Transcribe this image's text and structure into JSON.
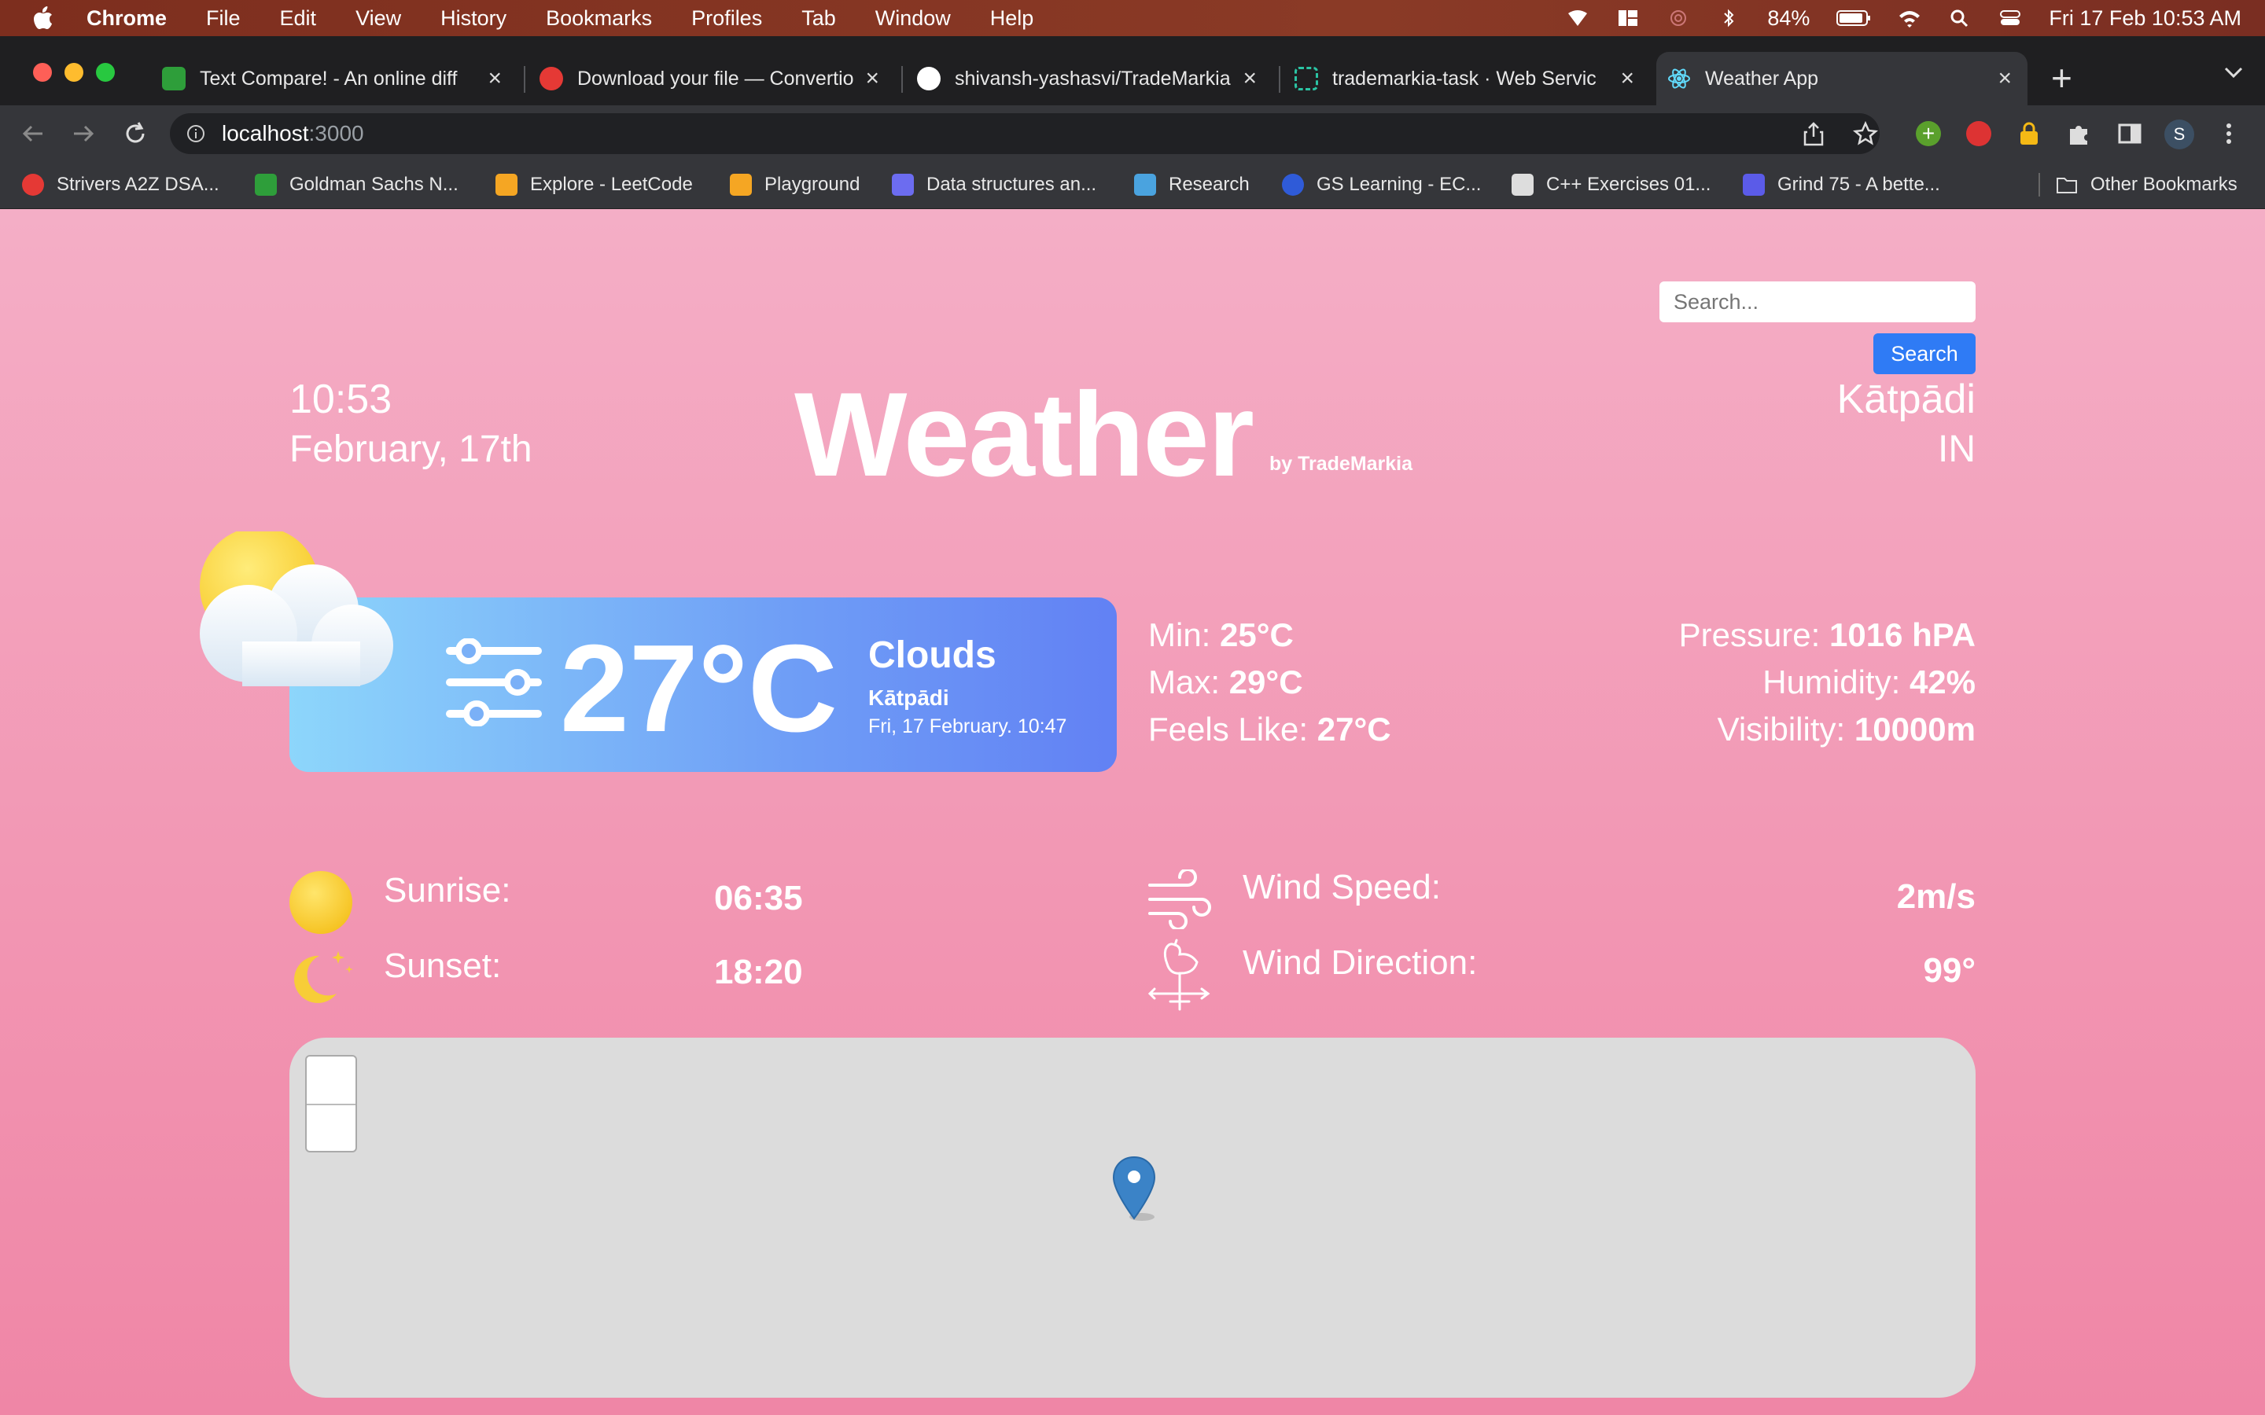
{
  "menubar": {
    "app": "Chrome",
    "items": [
      "File",
      "Edit",
      "View",
      "History",
      "Bookmarks",
      "Profiles",
      "Tab",
      "Window",
      "Help"
    ],
    "battery": "84%",
    "datetime": "Fri 17 Feb  10:53 AM"
  },
  "tabs": [
    {
      "title": "Text Compare! - An online diff",
      "icon": "text-compare-favicon",
      "color": "#2e9e3a"
    },
    {
      "title": "Download your file — Convertio",
      "icon": "convertio-favicon",
      "color": "#e53935"
    },
    {
      "title": "shivansh-yashasvi/TradeMarkia",
      "icon": "github-favicon",
      "color": "#ffffff"
    },
    {
      "title": "trademarkia-task · Web Servic",
      "icon": "render-favicon",
      "color": "#2bc4a4"
    },
    {
      "title": "Weather App",
      "icon": "react-favicon",
      "color": "#61dafb"
    }
  ],
  "address": {
    "host": "localhost",
    "port": ":3000"
  },
  "bookmarks": [
    {
      "label": "Strivers A2Z DSA...",
      "color": "#e53935"
    },
    {
      "label": "Goldman Sachs N...",
      "color": "#2e9e3a"
    },
    {
      "label": "Explore - LeetCode",
      "color": "#f5a623"
    },
    {
      "label": "Playground",
      "color": "#f5a623"
    },
    {
      "label": "Data structures an...",
      "color": "#6c6cf0"
    },
    {
      "label": "Research",
      "color": "#4aa3df"
    },
    {
      "label": "GS Learning - EC...",
      "color": "#2f5bd8"
    },
    {
      "label": "C++ Exercises 01...",
      "color": "#dddddd"
    },
    {
      "label": "Grind 75 - A bette...",
      "color": "#5b5be8"
    }
  ],
  "other_bookmarks": "Other Bookmarks",
  "app": {
    "search_placeholder": "Search...",
    "search_button": "Search",
    "time": "10:53",
    "date": "February, 17th",
    "brand": "Weather",
    "brand_sub": "by TradeMarkia",
    "city": "Kātpādi",
    "country": "IN",
    "temperature": "27°C",
    "condition": "Clouds",
    "condition_city": "Kātpādi",
    "condition_date": "Fri, 17 February. 10:47",
    "min_label": "Min: ",
    "min_value": "25°C",
    "max_label": "Max: ",
    "max_value": "29°C",
    "feels_label": "Feels Like: ",
    "feels_value": "27°C",
    "pressure_label": "Pressure: ",
    "pressure_value": "1016 hPA",
    "humidity_label": "Humidity: ",
    "humidity_value": "42%",
    "visibility_label": "Visibility: ",
    "visibility_value": "10000m",
    "sunrise_label": "Sunrise:",
    "sunrise_value": "06:35",
    "sunset_label": "Sunset:",
    "sunset_value": "18:20",
    "wind_speed_label": "Wind Speed:",
    "wind_speed_value": "2m/s",
    "wind_dir_label": "Wind Direction:",
    "wind_dir_value": "99°"
  },
  "colors": {
    "page_top": "#f4aec6",
    "page_bottom": "#ef86a6",
    "card_left": "#8dd6fb",
    "card_right": "#6281f4",
    "search_button": "#2f7bf5",
    "map_bg": "#dcdcdc",
    "pin": "#3b83c7"
  }
}
